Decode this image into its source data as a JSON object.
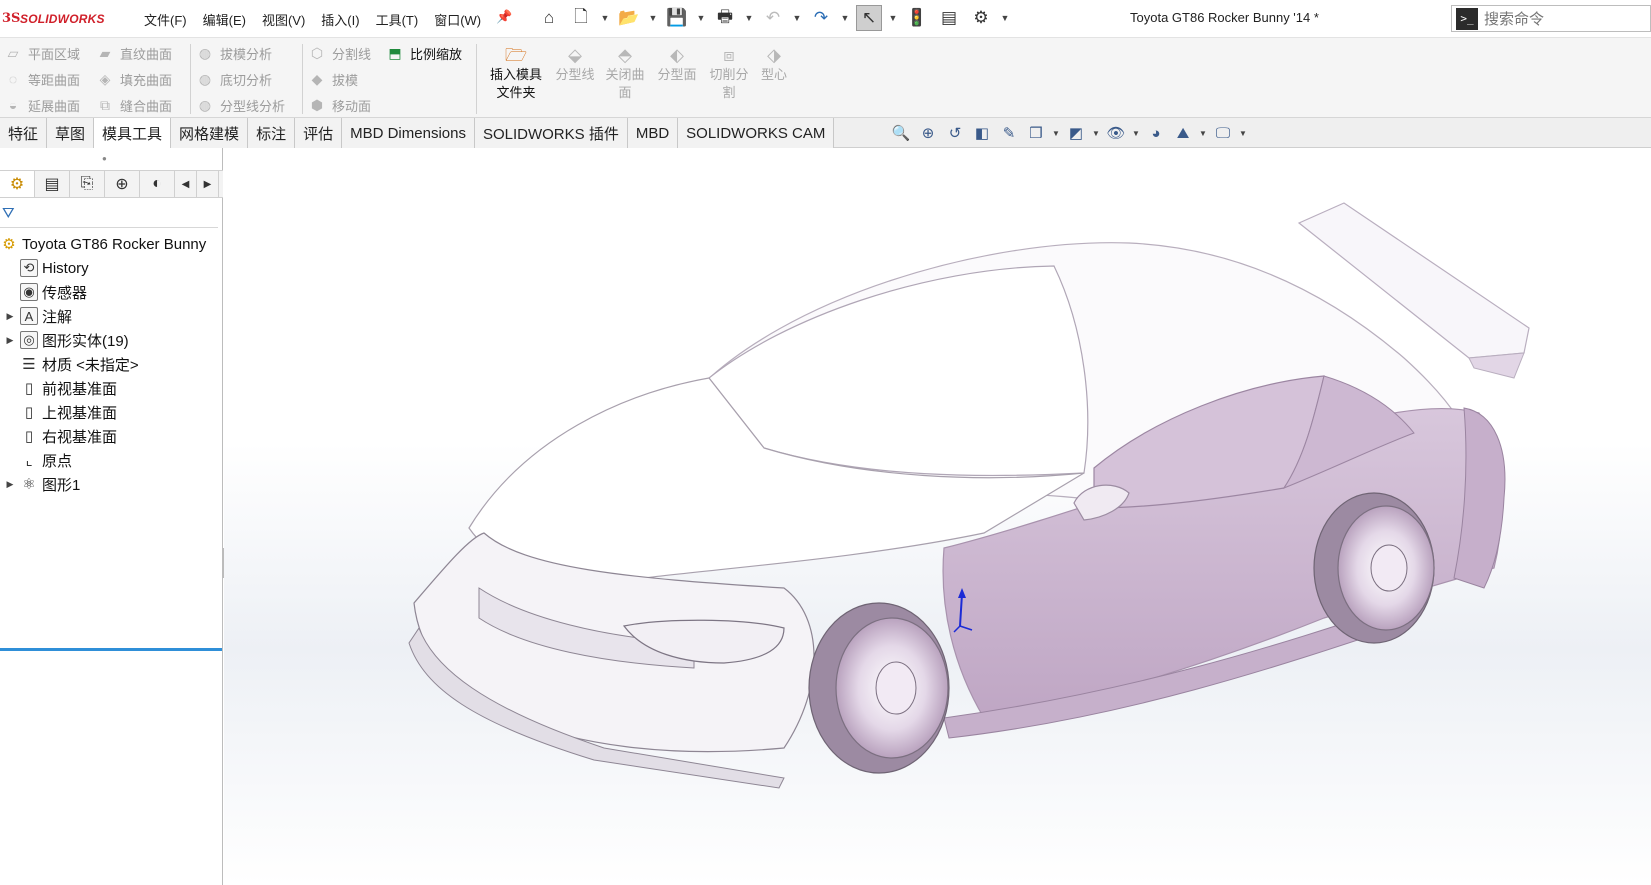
{
  "app": {
    "logo_mark": "3S",
    "logo_text": "SOLIDWORKS",
    "document_title": "Toyota GT86 Rocker Bunny '14 *"
  },
  "menu": {
    "items": [
      "文件(F)",
      "编辑(E)",
      "视图(V)",
      "插入(I)",
      "工具(T)",
      "窗口(W)"
    ]
  },
  "quick_tools": [
    {
      "name": "home-icon",
      "glyph": "⌂"
    },
    {
      "name": "new-document-icon",
      "glyph": "🗋"
    },
    {
      "name": "open-folder-icon",
      "glyph": "📂"
    },
    {
      "name": "save-icon",
      "glyph": "💾"
    },
    {
      "name": "print-icon",
      "glyph": "🖶"
    },
    {
      "name": "undo-icon",
      "glyph": "↶"
    },
    {
      "name": "redo-icon",
      "glyph": "↷"
    },
    {
      "name": "select-pointer-icon",
      "glyph": "↖"
    },
    {
      "name": "rebuild-traffic-light-icon",
      "glyph": "🚦"
    },
    {
      "name": "file-properties-icon",
      "glyph": "▤"
    },
    {
      "name": "options-gear-icon",
      "glyph": "⚙"
    }
  ],
  "search": {
    "icon_text": ">_",
    "placeholder": "搜索命令"
  },
  "ribbon": {
    "col1": [
      "平面区域",
      "等距曲面",
      "延展曲面"
    ],
    "col2": [
      "直纹曲面",
      "填充曲面",
      "缝合曲面"
    ],
    "col3": [
      "拔模分析",
      "底切分析",
      "分型线分析"
    ],
    "col4": [
      "分割线",
      "拔模",
      "移动面"
    ],
    "scale": "比例缩放",
    "insert_mold_folder": "插入模具文件夹",
    "insert_mold_folder_line1": "插入模具",
    "insert_mold_folder_line2": "文件夹",
    "parting_line": "分型线",
    "shut_off_line1": "关闭曲",
    "shut_off_line2": "面",
    "parting_surface": "分型面",
    "tooling_split_line1": "切削分",
    "tooling_split_line2": "割",
    "core": "型心"
  },
  "tabs": [
    {
      "label": "特征",
      "active": false
    },
    {
      "label": "草图",
      "active": false
    },
    {
      "label": "模具工具",
      "active": true
    },
    {
      "label": "网格建模",
      "active": false
    },
    {
      "label": "标注",
      "active": false
    },
    {
      "label": "评估",
      "active": false
    },
    {
      "label": "MBD Dimensions",
      "active": false
    },
    {
      "label": "SOLIDWORKS 插件",
      "active": false
    },
    {
      "label": "MBD",
      "active": false
    },
    {
      "label": "SOLIDWORKS CAM",
      "active": false
    }
  ],
  "feature_tree": {
    "root": "Toyota GT86 Rocker Bunny",
    "items": [
      {
        "label": "History",
        "icon": "history-icon",
        "expandable": false
      },
      {
        "label": "传感器",
        "icon": "sensor-icon",
        "expandable": false
      },
      {
        "label": "注解",
        "icon": "annotation-icon",
        "expandable": true
      },
      {
        "label": "图形实体(19)",
        "icon": "graphics-body-icon",
        "expandable": true
      },
      {
        "label": "材质 <未指定>",
        "icon": "material-icon",
        "expandable": false
      },
      {
        "label": "前视基准面",
        "icon": "plane-icon",
        "expandable": false
      },
      {
        "label": "上视基准面",
        "icon": "plane-icon",
        "expandable": false
      },
      {
        "label": "右视基准面",
        "icon": "plane-icon",
        "expandable": false
      },
      {
        "label": "原点",
        "icon": "origin-icon",
        "expandable": false
      },
      {
        "label": "图形1",
        "icon": "graphics-icon",
        "expandable": true
      }
    ]
  },
  "colors": {
    "brand_red": "#d0202a",
    "tree_end_line": "#2f8fd8",
    "car_body": "#c8b2cc"
  }
}
